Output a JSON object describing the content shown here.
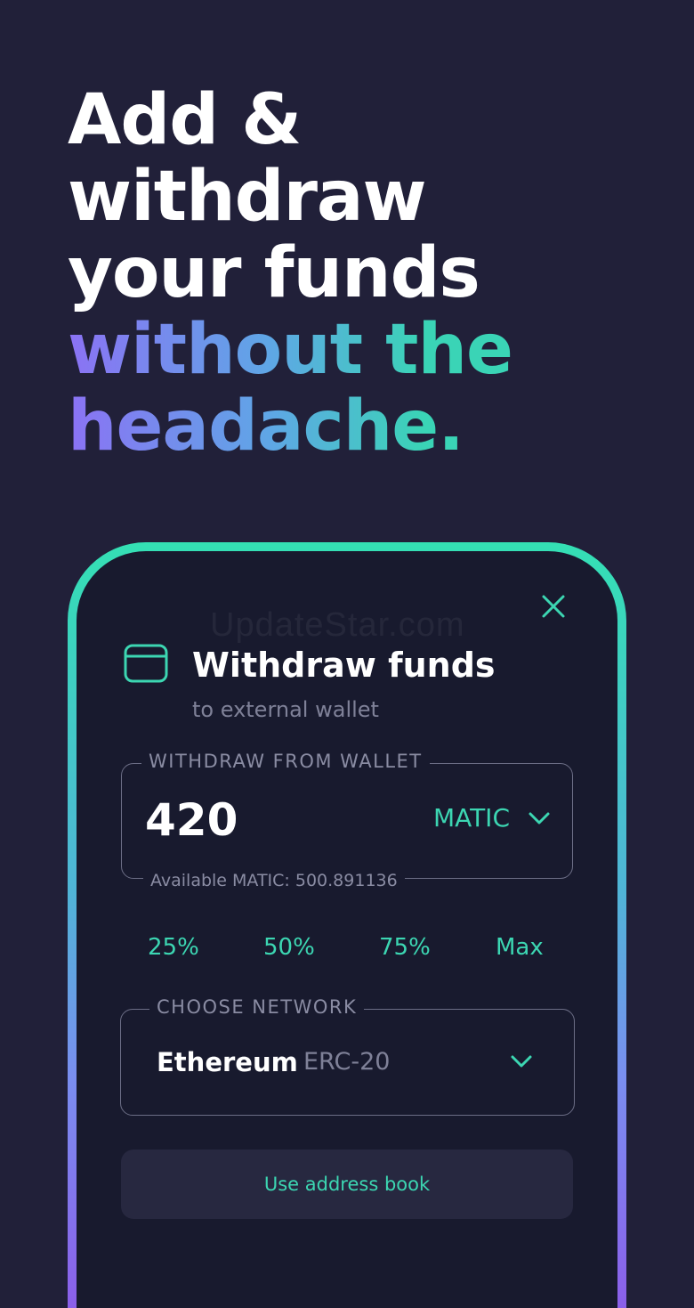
{
  "headline": {
    "line1": "Add &",
    "line2": "withdraw",
    "line3": "your funds",
    "line4": "without the",
    "line5": "headache."
  },
  "watermark": "UpdateStar.com",
  "dialog": {
    "title": "Withdraw funds",
    "subtitle": "to external wallet",
    "amount_field": {
      "legend": "WITHDRAW FROM WALLET",
      "value": "420",
      "currency": "MATIC",
      "helper": "Available MATIC: 500.891136"
    },
    "percent_options": [
      "25%",
      "50%",
      "75%",
      "Max"
    ],
    "network_field": {
      "legend": "CHOOSE NETWORK",
      "name": "Ethereum",
      "standard": "ERC-20"
    },
    "address_book_label": "Use address book"
  },
  "colors": {
    "background": "#212039",
    "screen": "#181a2e",
    "accent": "#3cd6b2",
    "gradient_start": "#8b72f4",
    "gradient_end": "#3ad4b6"
  },
  "icons": [
    "close-icon",
    "wallet-icon",
    "chevron-down-icon"
  ]
}
